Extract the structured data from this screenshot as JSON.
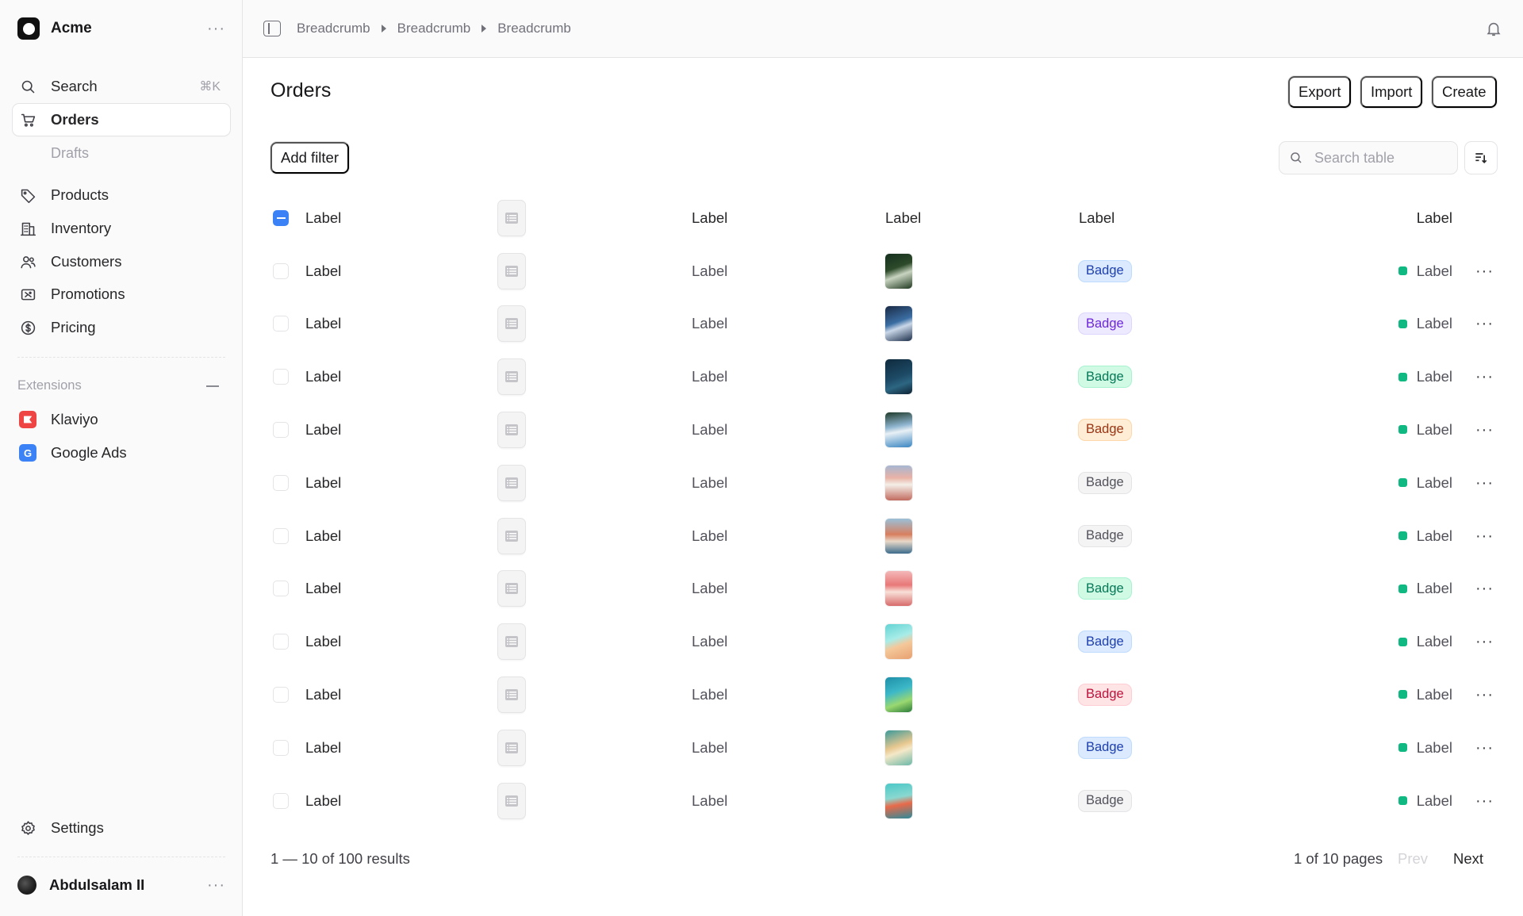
{
  "sidebar": {
    "brand": "Acme",
    "search_label": "Search",
    "search_shortcut": "⌘K",
    "nav": [
      {
        "label": "Orders",
        "icon": "cart-icon",
        "active": true
      },
      {
        "label": "Products",
        "icon": "tag-icon"
      },
      {
        "label": "Inventory",
        "icon": "building-icon"
      },
      {
        "label": "Customers",
        "icon": "users-icon"
      },
      {
        "label": "Promotions",
        "icon": "ticket-icon"
      },
      {
        "label": "Pricing",
        "icon": "dollar-circle-icon"
      }
    ],
    "orders_sub": "Drafts",
    "extensions_label": "Extensions",
    "extensions": [
      {
        "label": "Klaviyo",
        "color": "#ef4444"
      },
      {
        "label": "Google Ads",
        "color": "#3b82f6"
      }
    ],
    "settings_label": "Settings",
    "user_name": "Abdulsalam II"
  },
  "topbar": {
    "breadcrumbs": [
      "Breadcrumb",
      "Breadcrumb",
      "Breadcrumb"
    ]
  },
  "page": {
    "title": "Orders",
    "export_label": "Export",
    "import_label": "Import",
    "create_label": "Create",
    "add_filter_label": "Add filter",
    "search_placeholder": "Search table"
  },
  "table": {
    "headers": [
      "Label",
      "Label",
      "Label",
      "Label",
      "Label"
    ],
    "rows": [
      {
        "label1": "Label",
        "label2": "Label",
        "badge": "Badge",
        "badge_color": "blue",
        "status": "Label"
      },
      {
        "label1": "Label",
        "label2": "Label",
        "badge": "Badge",
        "badge_color": "purple",
        "status": "Label"
      },
      {
        "label1": "Label",
        "label2": "Label",
        "badge": "Badge",
        "badge_color": "green",
        "status": "Label"
      },
      {
        "label1": "Label",
        "label2": "Label",
        "badge": "Badge",
        "badge_color": "orange",
        "status": "Label"
      },
      {
        "label1": "Label",
        "label2": "Label",
        "badge": "Badge",
        "badge_color": "grey",
        "status": "Label"
      },
      {
        "label1": "Label",
        "label2": "Label",
        "badge": "Badge",
        "badge_color": "grey",
        "status": "Label"
      },
      {
        "label1": "Label",
        "label2": "Label",
        "badge": "Badge",
        "badge_color": "green",
        "status": "Label"
      },
      {
        "label1": "Label",
        "label2": "Label",
        "badge": "Badge",
        "badge_color": "blue",
        "status": "Label"
      },
      {
        "label1": "Label",
        "label2": "Label",
        "badge": "Badge",
        "badge_color": "red",
        "status": "Label"
      },
      {
        "label1": "Label",
        "label2": "Label",
        "badge": "Badge",
        "badge_color": "blue",
        "status": "Label"
      },
      {
        "label1": "Label",
        "label2": "Label",
        "badge": "Badge",
        "badge_color": "grey",
        "status": "Label"
      }
    ]
  },
  "footer": {
    "results": "1 — 10 of 100 results",
    "pages": "1 of 10 pages",
    "prev_label": "Prev",
    "next_label": "Next"
  },
  "colors": {
    "accent": "#3b82f6",
    "status_green": "#10b981"
  }
}
